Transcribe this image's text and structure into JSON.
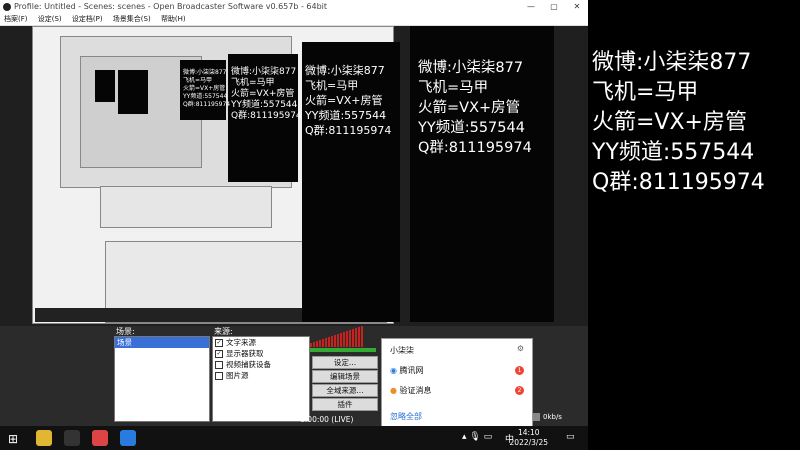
{
  "window": {
    "title": "Profile: Untitled - Scenes: scenes - Open Broadcaster Software v0.657b - 64bit"
  },
  "menu": [
    "档案(F)",
    "设定(S)",
    "设定档(P)",
    "场景集合(S)",
    "帮助(H)"
  ],
  "overlay_lines": [
    "微博:小柒柒877",
    "飞机=马甲",
    "火箭=VX+房管",
    "YY频道:557544",
    "Q群:811195974"
  ],
  "scenes": {
    "label": "场景:",
    "items": [
      "场景"
    ]
  },
  "sources": {
    "label": "来源:",
    "items": [
      {
        "label": "文字来源",
        "checked": true
      },
      {
        "label": "显示器获取",
        "checked": true
      },
      {
        "label": "视频捕获设备",
        "checked": false
      },
      {
        "label": "图片源",
        "checked": false
      }
    ]
  },
  "controls": {
    "settings": "设定...",
    "edit_scene": "编辑场景",
    "fullscreen_preview": "全域来源...",
    "plugins": "插件"
  },
  "status": {
    "time": "0:00:00 (LIVE)",
    "rate": "0kb/s"
  },
  "popup": {
    "title": "小柒柒",
    "items": [
      {
        "label": "腾讯网",
        "badge": "1"
      },
      {
        "label": "验证消息",
        "badge": "2"
      }
    ],
    "footer": "忽略全部"
  },
  "taskbar": {
    "time": "14:10",
    "date": "2022/3/25",
    "ime": "中"
  },
  "colors": {
    "meter": "#c8221e",
    "badge": "#e43"
  }
}
